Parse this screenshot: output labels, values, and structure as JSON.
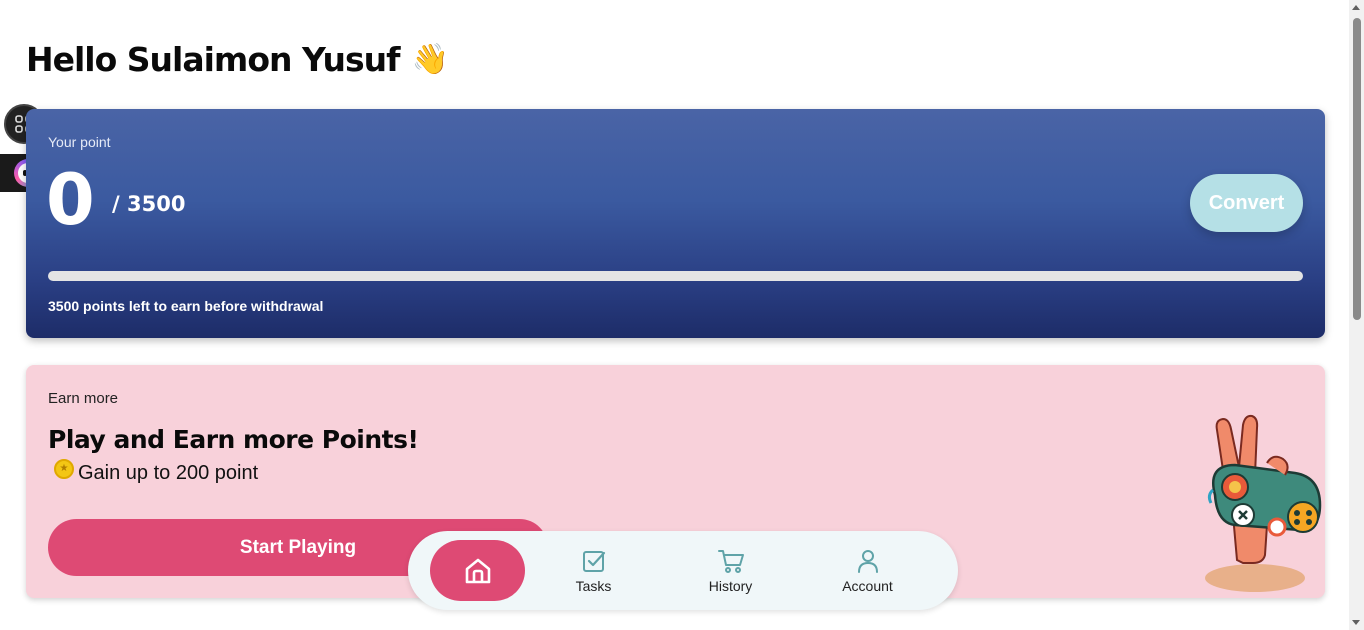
{
  "header": {
    "greeting": "Hello Sulaimon Yusuf",
    "wave_emoji": "👋"
  },
  "points_card": {
    "label": "Your point",
    "value": "0",
    "total": "/ 3500",
    "convert_label": "Convert",
    "progress_fraction": 0,
    "hint": "3500 points left to earn before withdrawal"
  },
  "earn_card": {
    "label": "Earn more",
    "title": "Play and Earn more Points!",
    "gain": "Gain up to 200 point",
    "start_label": "Start Playing"
  },
  "bottom_nav": {
    "items": [
      {
        "label": "",
        "icon": "home-icon"
      },
      {
        "label": "Tasks",
        "icon": "tasks-icon"
      },
      {
        "label": "History",
        "icon": "cart-icon"
      },
      {
        "label": "Account",
        "icon": "user-icon"
      }
    ]
  },
  "colors": {
    "accent_pink": "#de4a74",
    "card_blue": "#3b5aa0",
    "earn_bg": "#f8d1da",
    "convert_bg": "#b5e0e6"
  }
}
